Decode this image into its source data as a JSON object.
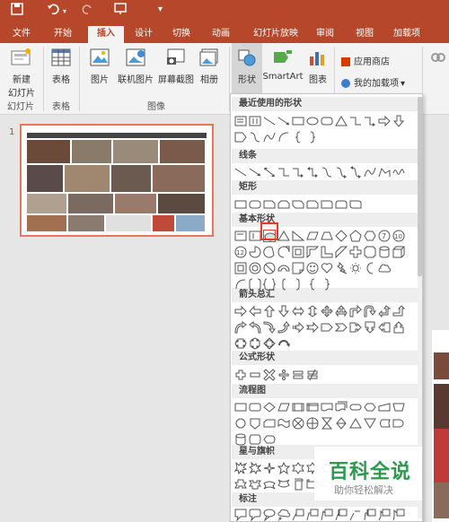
{
  "quick_access": {
    "save_icon": "save-icon",
    "undo_icon": "undo-icon",
    "redo_icon": "redo-icon",
    "present_icon": "present-icon"
  },
  "tabs": [
    "文件",
    "开始",
    "插入",
    "设计",
    "切换",
    "动画",
    "幻灯片放映",
    "审阅",
    "视图",
    "加载项"
  ],
  "active_tab": "插入",
  "ribbon": {
    "new_slide": "新建\n幻灯片",
    "table": "表格",
    "picture": "图片",
    "online_picture": "联机图片",
    "screenshot": "屏幕截图",
    "album": "相册",
    "shapes": "形状",
    "smartart": "SmartArt",
    "chart": "图表",
    "store": "应用商店",
    "my_addins": "我的加载项",
    "groups": {
      "slides": "幻灯片",
      "tables": "表格",
      "images": "图像"
    }
  },
  "slide": {
    "number": "1"
  },
  "dropdown": {
    "sections": [
      "最近使用的形状",
      "线条",
      "矩形",
      "基本形状",
      "箭头总汇",
      "公式形状",
      "流程图",
      "星与旗帜",
      "标注"
    ]
  },
  "watermark": {
    "line1": "百科全说",
    "line2": "助你轻松解决"
  },
  "colors": {
    "accent": "#b7472a",
    "highlight": "#e23b2e",
    "slide_border": "#e8765a",
    "brand_green": "#2b9a4d"
  }
}
